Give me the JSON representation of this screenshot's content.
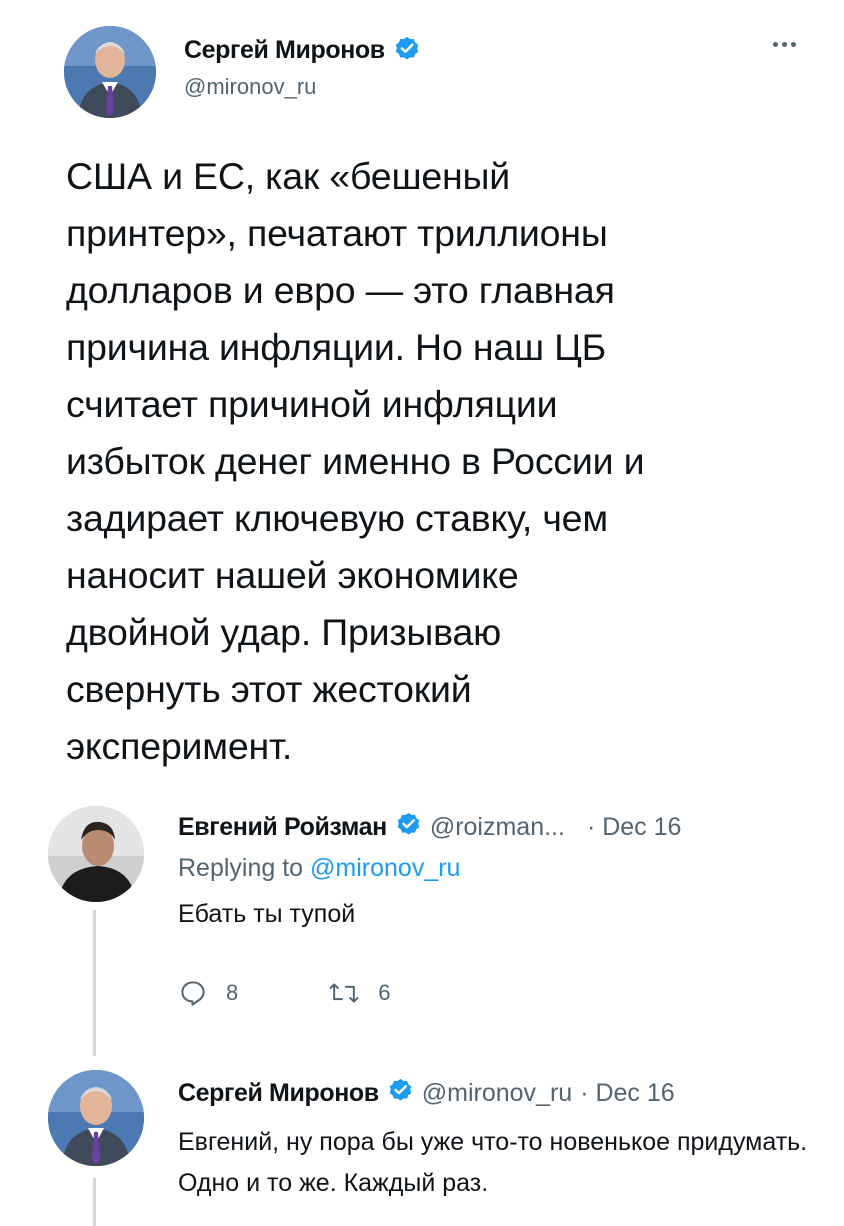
{
  "main_tweet": {
    "author_name": "Сергей Миронов",
    "handle": "@mironov_ru",
    "text": "США и ЕС, как «бешеный\nпринтер», печатают триллионы\nдолларов и евро — это главная\nпричина инфляции. Но наш ЦБ\nсчитает причиной инфляции\nизбыток денег именно в России и\nзадирает ключевую ставку, чем\nнаносит нашей экономике\nдвойной удар. Призываю\nсвернуть этот жестокий\nэксперимент.",
    "more_icon": "more-horizontal-icon"
  },
  "replies": [
    {
      "author_name": "Евгений Ройзман",
      "handle": "@roizman...",
      "date": "· Dec 16",
      "replying_to_prefix": "Replying to ",
      "replying_to_handle": "@mironov_ru",
      "text": "Ебать ты тупой",
      "reply_count": "8",
      "retweet_count": "6"
    },
    {
      "author_name": "Сергей Миронов",
      "handle": "@mironov_ru",
      "date": "· Dec 16",
      "text": "Евгений, ну пора бы уже что-то новенькое придумать. Одно и то же. Каждый раз."
    }
  ],
  "colors": {
    "verified": "#1d9bf0",
    "mention": "#1d9bf0",
    "secondary_text": "#536471",
    "thread_line": "#cfd9de"
  }
}
